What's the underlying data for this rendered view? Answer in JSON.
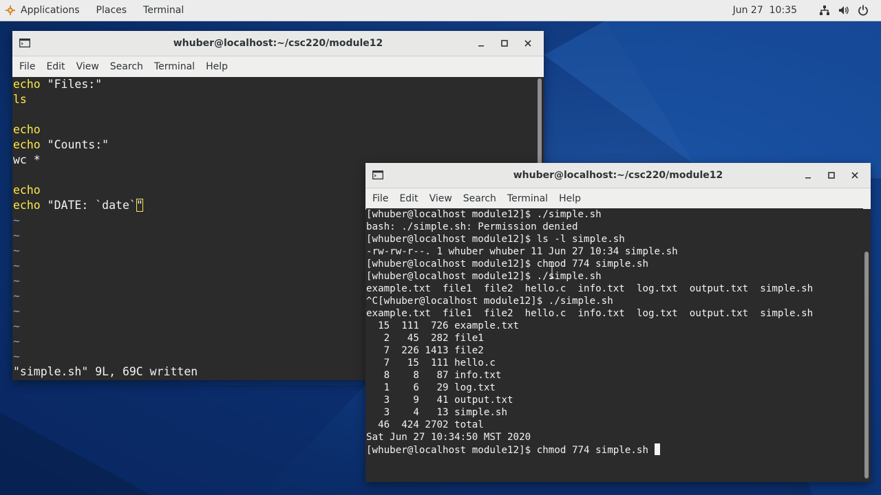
{
  "topbar": {
    "applications": "Applications",
    "places": "Places",
    "terminal": "Terminal",
    "clock": "Jun 27  10:35",
    "icons": [
      "network-icon",
      "volume-icon",
      "power-icon"
    ]
  },
  "vim_window": {
    "title": "whuber@localhost:~/csc220/module12",
    "menu": [
      "File",
      "Edit",
      "View",
      "Search",
      "Terminal",
      "Help"
    ],
    "lines": [
      {
        "kw": "echo",
        "rest": " \"Files:\""
      },
      {
        "kw": "ls",
        "rest": ""
      },
      {
        "kw": "",
        "rest": ""
      },
      {
        "kw": "echo",
        "rest": ""
      },
      {
        "kw": "echo",
        "rest": " \"Counts:\""
      },
      {
        "kw": "",
        "rest": "wc *"
      },
      {
        "kw": "",
        "rest": ""
      },
      {
        "kw": "echo",
        "rest": ""
      },
      {
        "kw": "echo",
        "rest": " \"DATE: `date`",
        "cursor_char": "\""
      }
    ],
    "tilde_count": 10,
    "tilde": "~",
    "status": "\"simple.sh\" 9L, 69C written"
  },
  "term_window": {
    "title": "whuber@localhost:~/csc220/module12",
    "menu": [
      "File",
      "Edit",
      "View",
      "Search",
      "Terminal",
      "Help"
    ],
    "lines": [
      "[whuber@localhost module12]$ ./simple.sh",
      "bash: ./simple.sh: Permission denied",
      "[whuber@localhost module12]$ ls -l simple.sh",
      "-rw-rw-r--. 1 whuber whuber 11 Jun 27 10:34 simple.sh",
      "[whuber@localhost module12]$ chmod 774 simple.sh",
      "[whuber@localhost module12]$ ./simple.sh",
      "example.txt  file1  file2  hello.c  info.txt  log.txt  output.txt  simple.sh",
      "^C[whuber@localhost module12]$ ./simple.sh",
      "example.txt  file1  file2  hello.c  info.txt  log.txt  output.txt  simple.sh",
      "  15  111  726 example.txt",
      "   2   45  282 file1",
      "   7  226 1413 file2",
      "   7   15  111 hello.c",
      "   8    8   87 info.txt",
      "   1    6   29 log.txt",
      "   3    9   41 output.txt",
      "   3    4   13 simple.sh",
      "  46  424 2702 total",
      "Sat Jun 27 10:34:50 MST 2020"
    ],
    "prompt_line": "[whuber@localhost module12]$ chmod 774 simple.sh "
  },
  "colors": {
    "desktop": "#123e86",
    "terminal_bg": "#2b2b2b",
    "terminal_fg": "#f3f3f3",
    "vim_keyword": "#fce94f",
    "vim_tilde": "#729fcf",
    "titlebar": "#e8e8e7"
  }
}
